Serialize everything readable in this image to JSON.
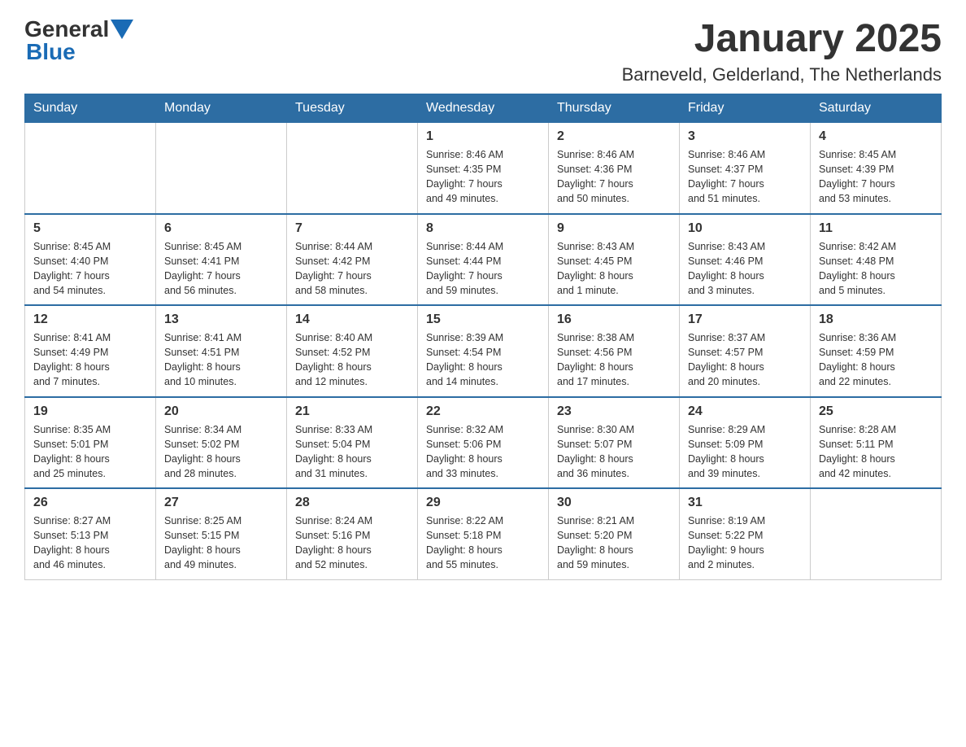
{
  "header": {
    "logo_general": "General",
    "logo_blue": "Blue",
    "title": "January 2025",
    "subtitle": "Barneveld, Gelderland, The Netherlands"
  },
  "weekdays": [
    "Sunday",
    "Monday",
    "Tuesday",
    "Wednesday",
    "Thursday",
    "Friday",
    "Saturday"
  ],
  "weeks": [
    [
      {
        "day": "",
        "info": ""
      },
      {
        "day": "",
        "info": ""
      },
      {
        "day": "",
        "info": ""
      },
      {
        "day": "1",
        "info": "Sunrise: 8:46 AM\nSunset: 4:35 PM\nDaylight: 7 hours\nand 49 minutes."
      },
      {
        "day": "2",
        "info": "Sunrise: 8:46 AM\nSunset: 4:36 PM\nDaylight: 7 hours\nand 50 minutes."
      },
      {
        "day": "3",
        "info": "Sunrise: 8:46 AM\nSunset: 4:37 PM\nDaylight: 7 hours\nand 51 minutes."
      },
      {
        "day": "4",
        "info": "Sunrise: 8:45 AM\nSunset: 4:39 PM\nDaylight: 7 hours\nand 53 minutes."
      }
    ],
    [
      {
        "day": "5",
        "info": "Sunrise: 8:45 AM\nSunset: 4:40 PM\nDaylight: 7 hours\nand 54 minutes."
      },
      {
        "day": "6",
        "info": "Sunrise: 8:45 AM\nSunset: 4:41 PM\nDaylight: 7 hours\nand 56 minutes."
      },
      {
        "day": "7",
        "info": "Sunrise: 8:44 AM\nSunset: 4:42 PM\nDaylight: 7 hours\nand 58 minutes."
      },
      {
        "day": "8",
        "info": "Sunrise: 8:44 AM\nSunset: 4:44 PM\nDaylight: 7 hours\nand 59 minutes."
      },
      {
        "day": "9",
        "info": "Sunrise: 8:43 AM\nSunset: 4:45 PM\nDaylight: 8 hours\nand 1 minute."
      },
      {
        "day": "10",
        "info": "Sunrise: 8:43 AM\nSunset: 4:46 PM\nDaylight: 8 hours\nand 3 minutes."
      },
      {
        "day": "11",
        "info": "Sunrise: 8:42 AM\nSunset: 4:48 PM\nDaylight: 8 hours\nand 5 minutes."
      }
    ],
    [
      {
        "day": "12",
        "info": "Sunrise: 8:41 AM\nSunset: 4:49 PM\nDaylight: 8 hours\nand 7 minutes."
      },
      {
        "day": "13",
        "info": "Sunrise: 8:41 AM\nSunset: 4:51 PM\nDaylight: 8 hours\nand 10 minutes."
      },
      {
        "day": "14",
        "info": "Sunrise: 8:40 AM\nSunset: 4:52 PM\nDaylight: 8 hours\nand 12 minutes."
      },
      {
        "day": "15",
        "info": "Sunrise: 8:39 AM\nSunset: 4:54 PM\nDaylight: 8 hours\nand 14 minutes."
      },
      {
        "day": "16",
        "info": "Sunrise: 8:38 AM\nSunset: 4:56 PM\nDaylight: 8 hours\nand 17 minutes."
      },
      {
        "day": "17",
        "info": "Sunrise: 8:37 AM\nSunset: 4:57 PM\nDaylight: 8 hours\nand 20 minutes."
      },
      {
        "day": "18",
        "info": "Sunrise: 8:36 AM\nSunset: 4:59 PM\nDaylight: 8 hours\nand 22 minutes."
      }
    ],
    [
      {
        "day": "19",
        "info": "Sunrise: 8:35 AM\nSunset: 5:01 PM\nDaylight: 8 hours\nand 25 minutes."
      },
      {
        "day": "20",
        "info": "Sunrise: 8:34 AM\nSunset: 5:02 PM\nDaylight: 8 hours\nand 28 minutes."
      },
      {
        "day": "21",
        "info": "Sunrise: 8:33 AM\nSunset: 5:04 PM\nDaylight: 8 hours\nand 31 minutes."
      },
      {
        "day": "22",
        "info": "Sunrise: 8:32 AM\nSunset: 5:06 PM\nDaylight: 8 hours\nand 33 minutes."
      },
      {
        "day": "23",
        "info": "Sunrise: 8:30 AM\nSunset: 5:07 PM\nDaylight: 8 hours\nand 36 minutes."
      },
      {
        "day": "24",
        "info": "Sunrise: 8:29 AM\nSunset: 5:09 PM\nDaylight: 8 hours\nand 39 minutes."
      },
      {
        "day": "25",
        "info": "Sunrise: 8:28 AM\nSunset: 5:11 PM\nDaylight: 8 hours\nand 42 minutes."
      }
    ],
    [
      {
        "day": "26",
        "info": "Sunrise: 8:27 AM\nSunset: 5:13 PM\nDaylight: 8 hours\nand 46 minutes."
      },
      {
        "day": "27",
        "info": "Sunrise: 8:25 AM\nSunset: 5:15 PM\nDaylight: 8 hours\nand 49 minutes."
      },
      {
        "day": "28",
        "info": "Sunrise: 8:24 AM\nSunset: 5:16 PM\nDaylight: 8 hours\nand 52 minutes."
      },
      {
        "day": "29",
        "info": "Sunrise: 8:22 AM\nSunset: 5:18 PM\nDaylight: 8 hours\nand 55 minutes."
      },
      {
        "day": "30",
        "info": "Sunrise: 8:21 AM\nSunset: 5:20 PM\nDaylight: 8 hours\nand 59 minutes."
      },
      {
        "day": "31",
        "info": "Sunrise: 8:19 AM\nSunset: 5:22 PM\nDaylight: 9 hours\nand 2 minutes."
      },
      {
        "day": "",
        "info": ""
      }
    ]
  ]
}
